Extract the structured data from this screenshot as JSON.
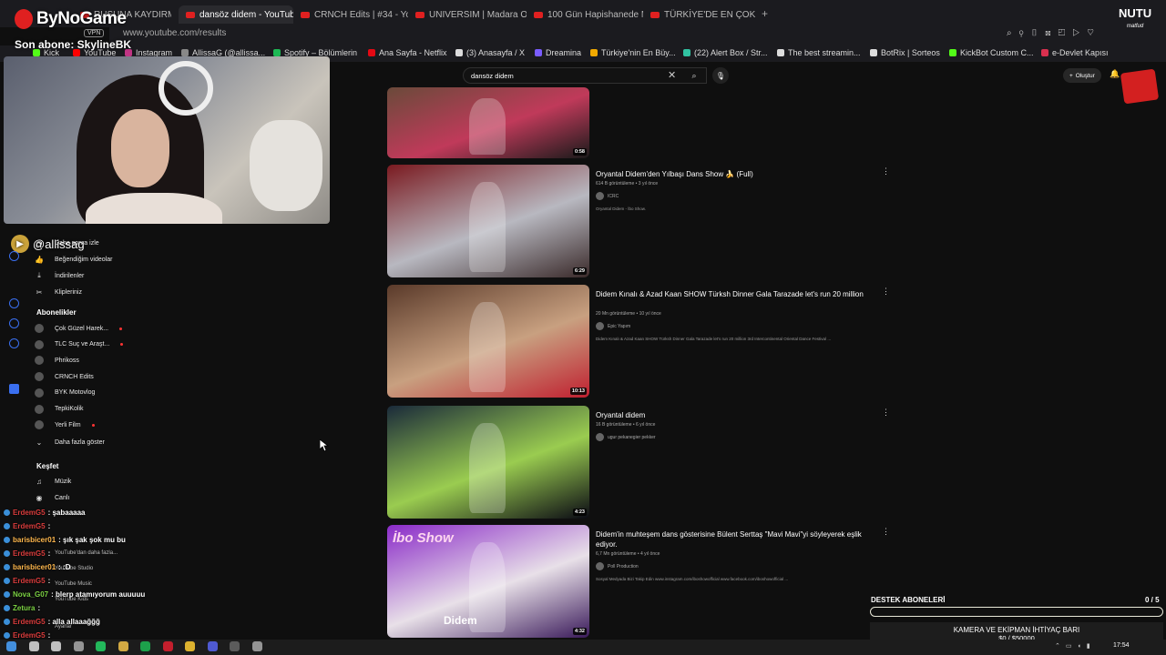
{
  "browser": {
    "tabs": [
      {
        "label": "RUSUNA KAYDIRMA 17/..."
      },
      {
        "label": "dansöz didem - YouTube"
      },
      {
        "label": "CRNCH Edits | #34 - You"
      },
      {
        "label": "UNIVERSIM | Madara Old"
      },
      {
        "label": "100 Gün Hapishanede Ma"
      },
      {
        "label": "TÜRKİYE'DE EN ÇOK YEN"
      }
    ],
    "new_tab": "+",
    "vpn_badge": "VPN",
    "url": "www.youtube.com/results",
    "bookmarks": [
      {
        "label": "Kick",
        "color": "#53fc18"
      },
      {
        "label": "YouTube",
        "color": "#ff0000"
      },
      {
        "label": "Instagram",
        "color": "#c13584"
      },
      {
        "label": "AllissaG (@allissa...",
        "color": "#888888"
      },
      {
        "label": "Spotify – Bölümlerin",
        "color": "#1db954"
      },
      {
        "label": "Ana Sayfa - Netflix",
        "color": "#e50914"
      },
      {
        "label": "(3) Anasayfa / X",
        "color": "#dddddd"
      },
      {
        "label": "Dreamina",
        "color": "#7a5cff"
      },
      {
        "label": "Türkiye'nin En Büy...",
        "color": "#f2a900"
      },
      {
        "label": "(22) Alert Box / Str...",
        "color": "#31c3a2"
      },
      {
        "label": "The best streamin...",
        "color": "#dddddd"
      },
      {
        "label": "BotRix | Sorteos",
        "color": "#dddddd"
      },
      {
        "label": "KickBot Custom C...",
        "color": "#53fc18"
      },
      {
        "label": "e-Devlet Kapısı",
        "color": "#d9304f"
      }
    ]
  },
  "overlay": {
    "channel_logo": "ByNoGame",
    "last_sub": "Son abone: SkylineBK",
    "handle": "@allissag",
    "nutu_label": "NUTU",
    "nutu_sub": "matfud"
  },
  "youtube": {
    "search_value": "dansöz didem",
    "create_label": "Oluştur",
    "sidebar": {
      "top_items": [
        {
          "label": "Daha sonra izle",
          "icon": "clock-icon"
        },
        {
          "label": "Beğendiğim videolar",
          "icon": "thumbs-up-icon"
        },
        {
          "label": "İndirilenler",
          "icon": "download-icon"
        },
        {
          "label": "Klipleriniz",
          "icon": "scissors-icon"
        }
      ],
      "subs_heading": "Abonelikler",
      "subs": [
        {
          "label": "Çok Güzel Harek...",
          "live": true
        },
        {
          "label": "TLC Suç ve Araşt...",
          "live": true
        },
        {
          "label": "Phrikoss",
          "live": false
        },
        {
          "label": "CRNCH Edits",
          "live": false
        },
        {
          "label": "BYK Motovlog",
          "live": false
        },
        {
          "label": "TepkiKolik",
          "live": false
        },
        {
          "label": "Yerli Film",
          "live": true
        }
      ],
      "show_more": "Daha fazla göster",
      "explore_heading": "Keşfet",
      "explore": [
        {
          "label": "Müzik",
          "icon": "music-icon"
        },
        {
          "label": "Canlı",
          "icon": "live-icon"
        }
      ],
      "hidden_items": [
        "YouTube'dan daha fazla...",
        "YouTube Studio",
        "YouTube Music",
        "YouTube Kids",
        "Ayarlar"
      ]
    },
    "videos": [
      {
        "title": "",
        "meta": "",
        "channel": "",
        "desc": "",
        "duration": "0:58",
        "thumb_colors": [
          "#6a4a3a",
          "#c03a5a",
          "#1a1a1a"
        ]
      },
      {
        "title": "Oryantal Didem'den Yılbaşı Dans Show 🍌 (Full)",
        "meta": "614 B görüntüleme • 3 yıl önce",
        "channel": "ICRC",
        "desc": "Oryantal Didem - İbo Show.",
        "duration": "6:29",
        "thumb_colors": [
          "#7a1a20",
          "#b8b8c0",
          "#3a2a2a"
        ]
      },
      {
        "title": "Didem Kınalı & Azad Kaan SHOW Türksh Dinner Gala Tarazade let's run 20 million",
        "meta": "20 Mn görüntüleme • 10 yıl önce",
        "channel": "Epic Yapım",
        "desc": "Didem Kınalı & Azad Kaan SHOW Türksh Dinner Gala Tarazade let's run 20 million 3rd Intercontinental Oriental Dance Festival ...",
        "duration": "10:13",
        "thumb_colors": [
          "#5a3a2a",
          "#c8a080",
          "#c02030"
        ]
      },
      {
        "title": "Oryantal didem",
        "meta": "16 B görüntüleme • 6 yıl önce",
        "channel": "ugur pekanegier pekker",
        "desc": "",
        "duration": "4:23",
        "thumb_colors": [
          "#1a2a3a",
          "#9acc50",
          "#0a0a14"
        ]
      },
      {
        "title": "Didem'in muhteşem dans gösterisine Bülent Serttaş \"Mavi Mavi\"yi söyleyerek eşlik ediyor.",
        "meta": "6,7 Mn görüntüleme • 4 yıl önce",
        "channel": "Poll Production",
        "desc": "Sosyal Medyada Bizi Takip Edin www.instagram.com/iboshowofficial www.facebook.com/iboshowofficial ...",
        "duration": "4:32",
        "thumb_colors": [
          "#8a2ac8",
          "#e8e0e8",
          "#3a1a5a"
        ],
        "thumb_caption": "Didem",
        "thumb_brand": "İbo Show"
      }
    ]
  },
  "chat": [
    {
      "user": "ErdemG5",
      "text": ": şabaaaaa",
      "color": "red"
    },
    {
      "user": "ErdemG5",
      "text": ":",
      "color": "red"
    },
    {
      "user": "barisbicer01",
      "text": ": şık şak şok mu bu",
      "color": "orange"
    },
    {
      "user": "ErdemG5",
      "text": ":",
      "color": "red"
    },
    {
      "user": "barisbicer01",
      "text": ": :D",
      "color": "orange"
    },
    {
      "user": "ErdemG5",
      "text": ":",
      "color": "red"
    },
    {
      "user": "Nova_G07",
      "text": ": blerp atamıyorum auuuuu",
      "color": "green"
    },
    {
      "user": "Zetura",
      "text": ":",
      "color": "green"
    },
    {
      "user": "ErdemG5",
      "text": ": alla allaaağğğ",
      "color": "red"
    },
    {
      "user": "ErdemG5",
      "text": ":",
      "color": "red"
    }
  ],
  "goal": {
    "title": "DESTEK ABONELERİ",
    "count": "0 / 5",
    "progress": 0,
    "equip_title": "KAMERA VE EKİPMAN İHTİYAÇ BARI",
    "equip_amount": "$0 / $50000"
  },
  "taskbar": {
    "clock": "17:54",
    "icons": [
      "windows-icon",
      "search-icon",
      "task-view-icon",
      "back-icon",
      "whatsapp-icon",
      "files-icon",
      "spotify-icon",
      "opera-icon",
      "chrome-icon",
      "discord-icon",
      "obs-icon",
      "settings-icon"
    ]
  }
}
